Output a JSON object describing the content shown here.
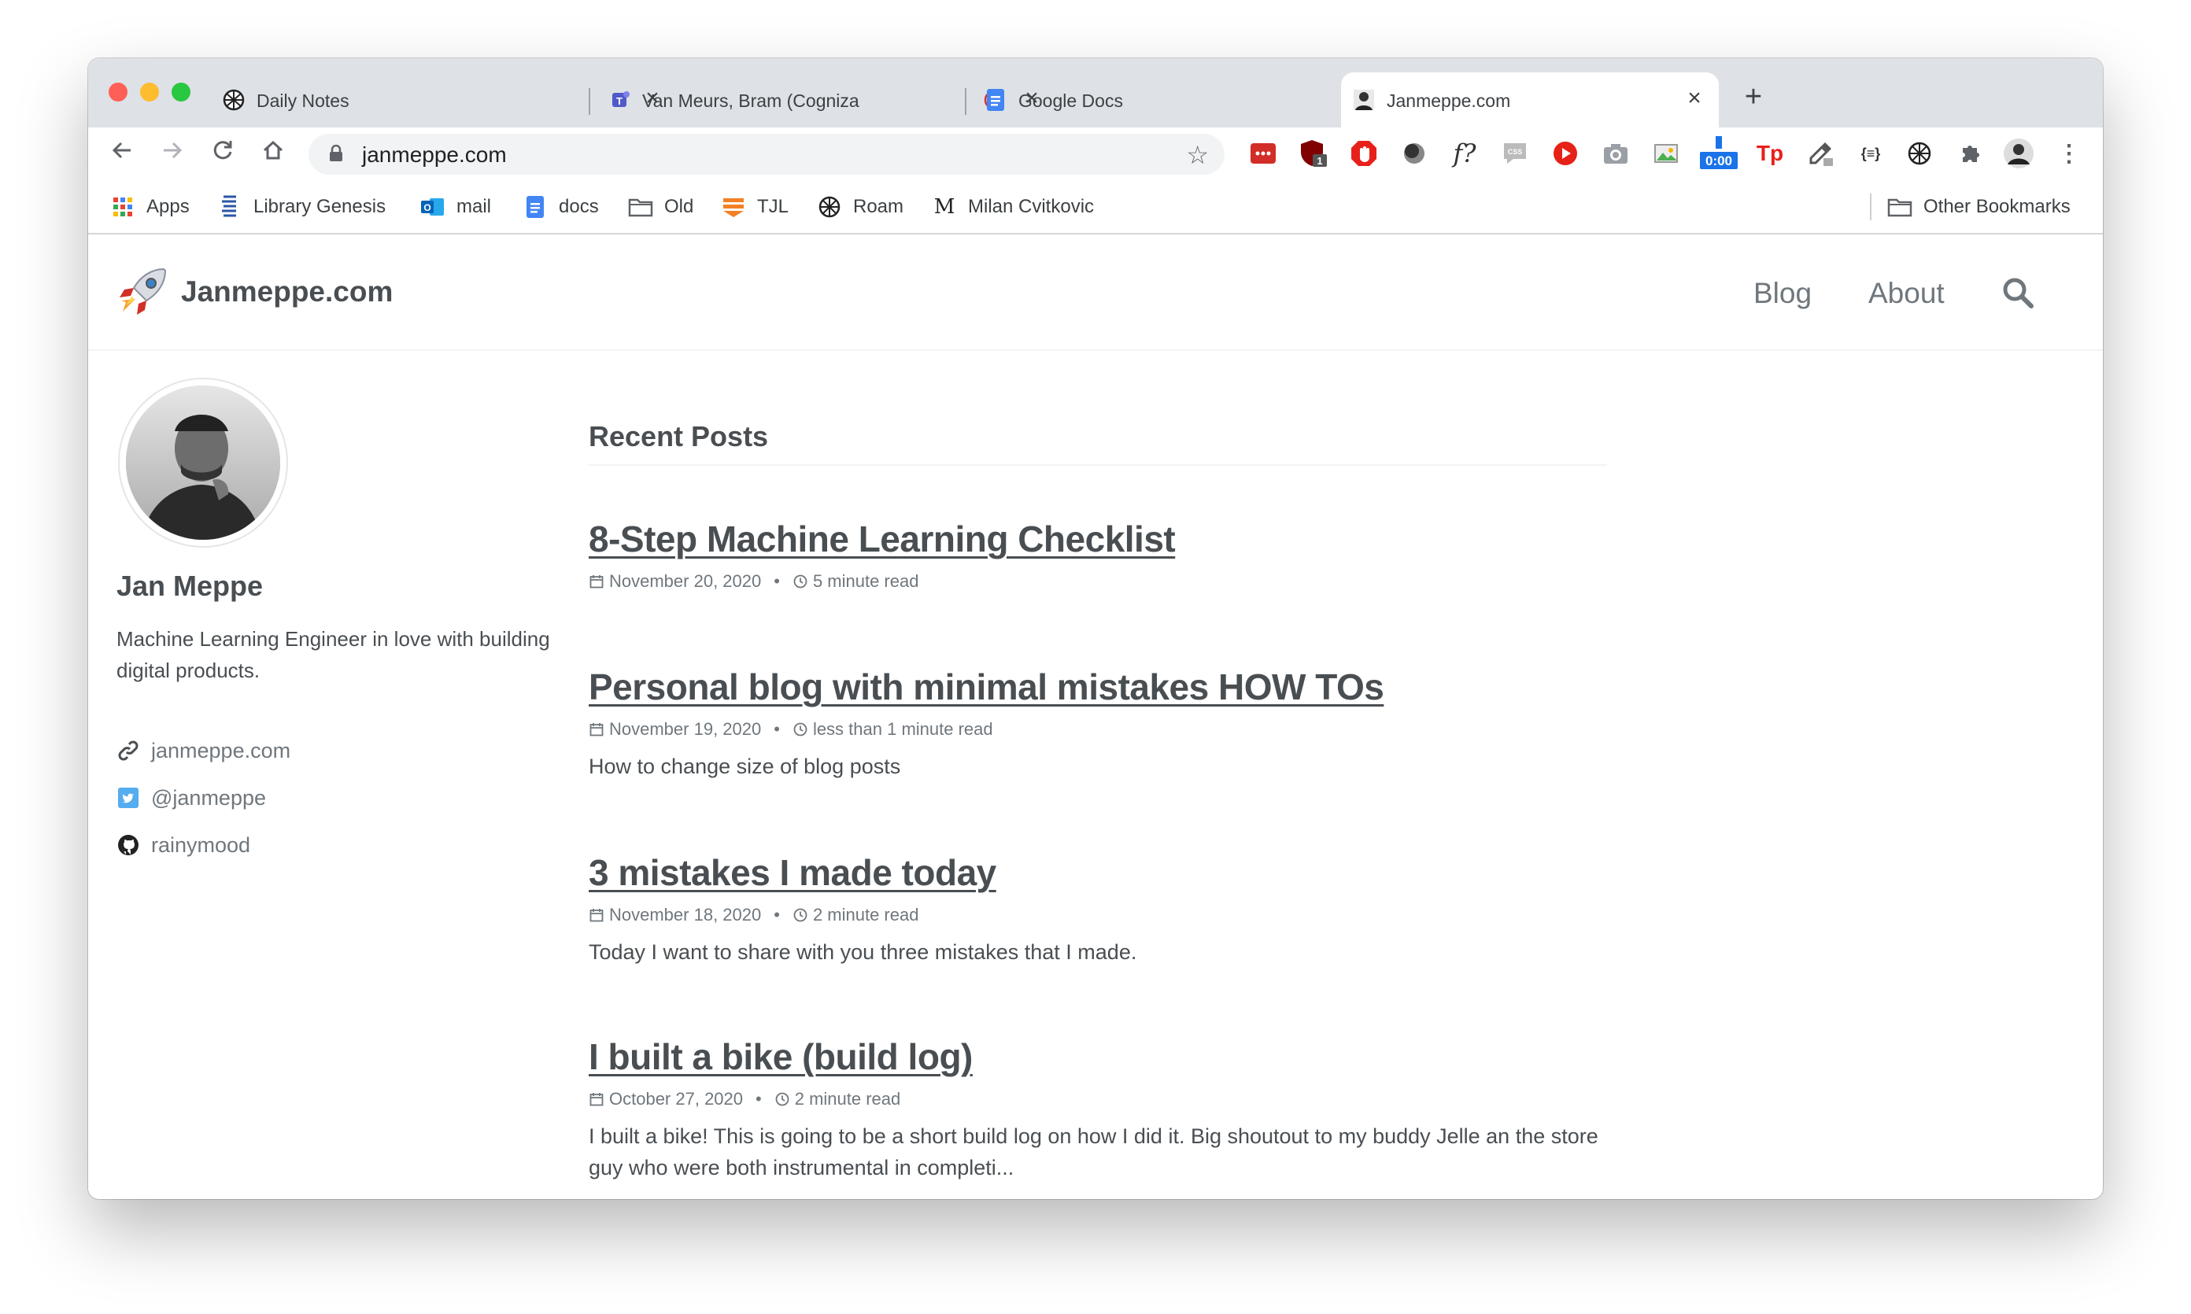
{
  "browser": {
    "tabs": [
      {
        "title": "Daily Notes",
        "close": "×",
        "favicon": "roam-icon"
      },
      {
        "title": "Van Meurs, Bram (Cogniza",
        "close": "×",
        "favicon": "teams-icon"
      },
      {
        "title": "Google Docs",
        "close": "×",
        "favicon": "docs-icon"
      },
      {
        "title": "Janmeppe.com",
        "close": "×",
        "favicon": "profile-icon"
      }
    ],
    "new_tab": "+",
    "url": "janmeppe.com",
    "extension_badges": {
      "ublock_count": "1",
      "timer": "0:00"
    },
    "bookmarks": [
      {
        "label": "Apps",
        "icon": "apps-grid-icon"
      },
      {
        "label": "Library Genesis",
        "icon": "library-icon"
      },
      {
        "label": "mail",
        "icon": "outlook-icon"
      },
      {
        "label": "docs",
        "icon": "docs-icon"
      },
      {
        "label": "Old",
        "icon": "folder-icon"
      },
      {
        "label": "TJL",
        "icon": "stack-icon"
      },
      {
        "label": "Roam",
        "icon": "roam-icon"
      },
      {
        "label": "Milan Cvitkovic",
        "icon": "medium-icon",
        "icon_glyph": "M"
      }
    ],
    "other_bookmarks": "Other Bookmarks"
  },
  "site": {
    "title": "Janmeppe.com",
    "nav": {
      "blog": "Blog",
      "about": "About"
    }
  },
  "author": {
    "name": "Jan Meppe",
    "bio": "Machine Learning Engineer in love with building digital products.",
    "links": [
      {
        "label": "janmeppe.com",
        "icon": "link-icon"
      },
      {
        "label": "@janmeppe",
        "icon": "twitter-icon"
      },
      {
        "label": "rainymood",
        "icon": "github-icon"
      }
    ]
  },
  "recent_posts": {
    "heading": "Recent Posts",
    "bullet": "•",
    "posts": [
      {
        "title": "8-Step Machine Learning Checklist",
        "date": "November 20, 2020",
        "read_time": "5 minute read",
        "excerpt": ""
      },
      {
        "title": "Personal blog with minimal mistakes HOW TOs",
        "date": "November 19, 2020",
        "read_time": "less than 1 minute read",
        "excerpt": "How to change size of blog posts"
      },
      {
        "title": "3 mistakes I made today",
        "date": "November 18, 2020",
        "read_time": "2 minute read",
        "excerpt": "Today I want to share with you three mistakes that I made."
      },
      {
        "title": "I built a bike (build log)",
        "date": "October 27, 2020",
        "read_time": "2 minute read",
        "excerpt": "I built a bike! This is going to be a short build log on how I did it. Big shoutout to my buddy Jelle an the store guy who were both instrumental in completi..."
      }
    ]
  },
  "colors": {
    "text": "#494e52",
    "muted": "#6f777d",
    "tabstrip": "#dee1e6"
  }
}
